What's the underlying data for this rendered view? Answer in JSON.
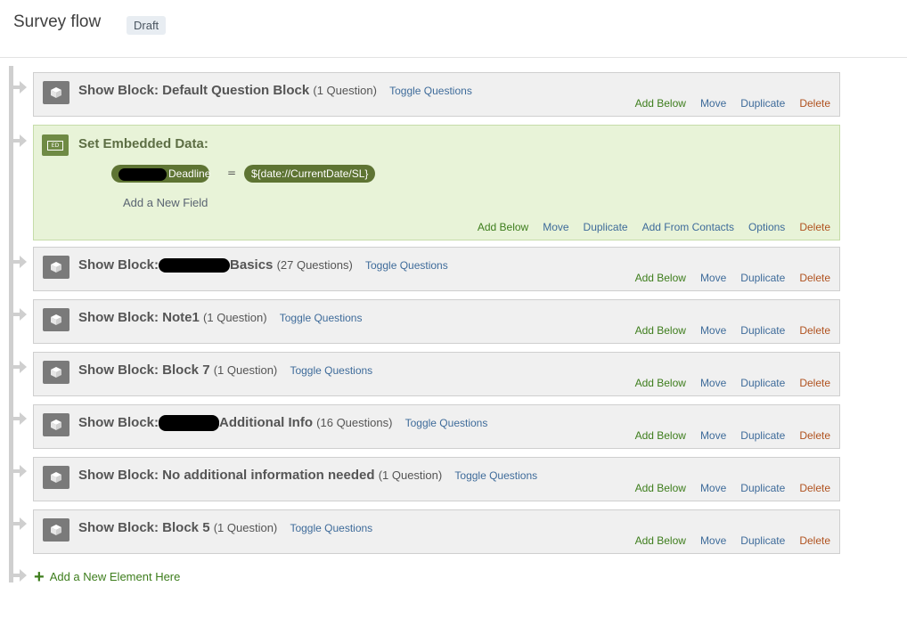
{
  "header": {
    "title": "Survey flow",
    "badge": "Draft"
  },
  "labels": {
    "add_below": "Add Below",
    "move": "Move",
    "duplicate": "Duplicate",
    "delete": "Delete",
    "toggle": "Toggle Questions"
  },
  "embedded": {
    "title": "Set Embedded Data:",
    "field_name_visible": "Deadline",
    "equals": "=",
    "field_value": "${date://CurrentDate/SL}",
    "add_field": "Add a New Field",
    "actions": {
      "add_below": "Add Below",
      "move": "Move",
      "duplicate": "Duplicate",
      "add_from_contacts": "Add From Contacts",
      "options": "Options",
      "delete": "Delete"
    }
  },
  "blocks": [
    {
      "prefix": "Show Block: Default Question Block",
      "suffix": "",
      "count": "(1 Question)"
    },
    {
      "prefix": "Show Block:",
      "suffix": "Basics",
      "count": "(27 Questions)"
    },
    {
      "prefix": "Show Block: Note1",
      "suffix": "",
      "count": "(1 Question)"
    },
    {
      "prefix": "Show Block: Block 7",
      "suffix": "",
      "count": "(1 Question)"
    },
    {
      "prefix": "Show Block:",
      "suffix": "Additional Info",
      "count": "(16 Questions)"
    },
    {
      "prefix": "Show Block: No additional information needed",
      "suffix": "",
      "count": "(1 Question)"
    },
    {
      "prefix": "Show Block: Block 5",
      "suffix": "",
      "count": "(1 Question)"
    }
  ],
  "add_new_element": "Add a New Element Here",
  "colors": {
    "add": "#3d7d1c",
    "link": "#3e6b9a",
    "delete": "#b0521f",
    "embedded_bg": "#e8f3d8",
    "pill": "#5e7433"
  }
}
